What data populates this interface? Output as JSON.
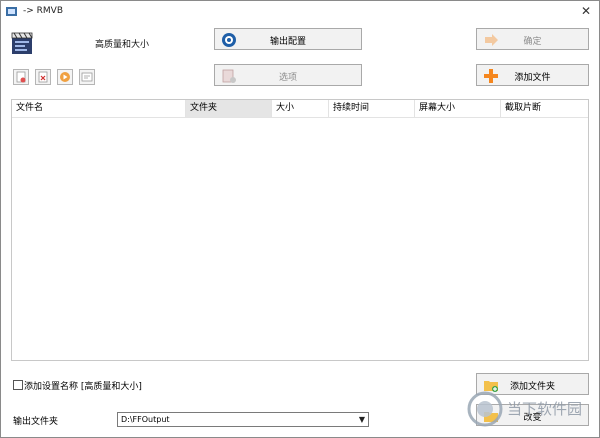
{
  "window": {
    "title": "-> RMVB",
    "close_glyph": "✕"
  },
  "profile": {
    "label": "高质量和大小",
    "icon": "clapperboard-icon"
  },
  "buttons": {
    "output_config": "输出配置",
    "ok": "确定",
    "options": "选项",
    "add_file": "添加文件",
    "add_folder": "添加文件夹",
    "change": "改变"
  },
  "tools": [
    "remove-file-icon",
    "clear-list-icon",
    "play-icon",
    "media-info-icon"
  ],
  "table": {
    "columns": [
      "文件名",
      "文件夹",
      "大小",
      "持续时间",
      "屏幕大小",
      "截取片断"
    ],
    "selected_column": 1,
    "rows": []
  },
  "settings_name": {
    "label": "添加设置名称 [高质量和大小]",
    "checked": false
  },
  "output_folder": {
    "label": "输出文件夹",
    "value": "D:\\FFOutput"
  },
  "watermark": {
    "text": "当下软件园"
  },
  "colors": {
    "accent_orange": "#f5871f",
    "disabled_text": "#8c8c8c",
    "border": "#a9a9a9"
  }
}
